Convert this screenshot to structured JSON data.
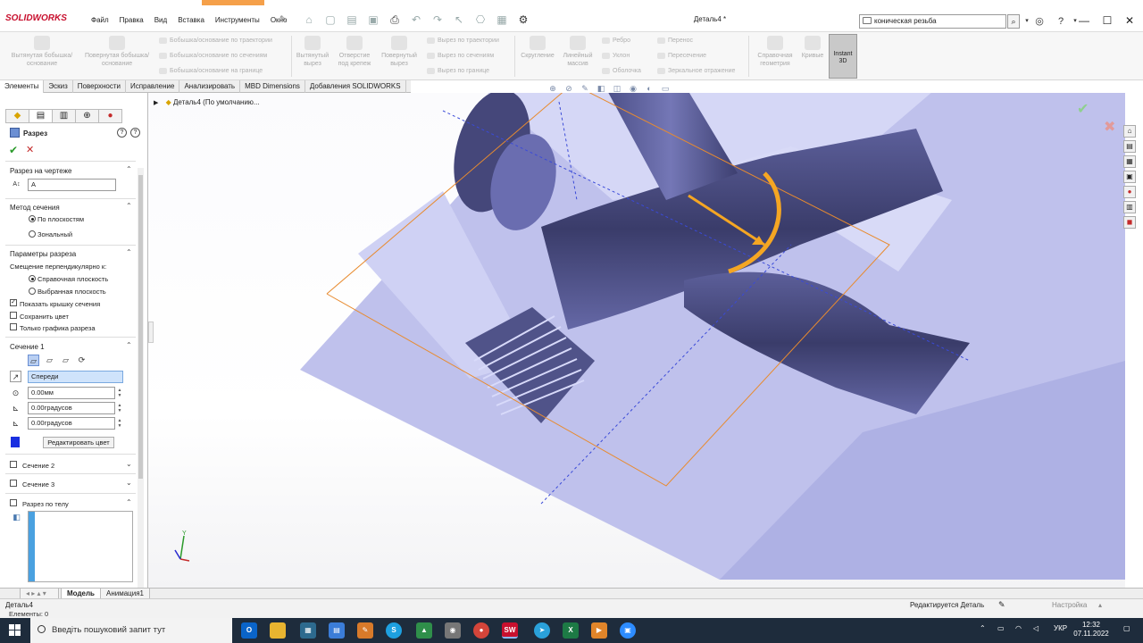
{
  "app": {
    "logo_text": "SOLIDWORKS",
    "doc_title": "Деталь4 *",
    "menu": [
      "Файл",
      "Правка",
      "Вид",
      "Вставка",
      "Инструменты",
      "Окно"
    ],
    "search_value": "коническая резьба"
  },
  "ribbon": {
    "extrude_boss": "Вытянутая бобышка/основание",
    "revolve_boss": "Повернутая бобышка/основание",
    "sweep_boss": "Бобышка/основание по траектории",
    "loft_boss": "Бобышка/основание по сечениям",
    "boundary_boss": "Бобышка/основание на границе",
    "extrude_cut": "Вытянутый вырез",
    "hole_wizard": "Отверстие под крепеж",
    "revolve_cut": "Повернутый вырез",
    "sweep_cut": "Вырез по траектории",
    "loft_cut": "Вырез по сечениям",
    "boundary_cut": "Вырез по границе",
    "fillet": "Скругление",
    "linear_pattern": "Линейный массив",
    "rib": "Ребро",
    "draft": "Уклон",
    "shell": "Оболочка",
    "wrap": "Перенос",
    "intersect": "Пересечение",
    "mirror": "Зеркальное отражение",
    "ref_geometry": "Справочная геометрия",
    "curves": "Кривые",
    "instant3d": "Instant 3D"
  },
  "tabs": [
    "Элементы",
    "Эскиз",
    "Поверхности",
    "Исправление",
    "Анализировать",
    "MBD Dimensions",
    "Добавления SOLIDWORKS"
  ],
  "panel": {
    "title": "Разрез",
    "section_drawing": {
      "header": "Разрез на чертеже",
      "value": "A"
    },
    "method": {
      "header": "Метод сечения",
      "opt_planes": "По плоскостям",
      "opt_zonal": "Зональный"
    },
    "params": {
      "header": "Параметры разреза",
      "offset_label": "Смещение перпендикулярно к:",
      "opt_ref_plane": "Справочная плоскость",
      "opt_sel_plane": "Выбранная плоскость",
      "show_cap": "Показать крышку сечения",
      "keep_color": "Сохранить цвет",
      "graphics_only": "Только графика разреза"
    },
    "section1": {
      "header": "Сечение 1",
      "plane": "Спереди",
      "offset": "0.00мм",
      "angle1": "0.00градусов",
      "angle2": "0.00градусов",
      "edit_color": "Редактировать цвет",
      "cap_color": "#1a2fe0"
    },
    "section2": "Сечение 2",
    "section3": "Сечение 3",
    "by_body": "Разрез по телу"
  },
  "tree": {
    "root": "Деталь4 (По умолчанию..."
  },
  "bottom_tabs": [
    "Модель",
    "Анимация1"
  ],
  "status": {
    "doc_name": "Деталь4",
    "elements": "Елементы: 0",
    "editing": "Редактируется Деталь",
    "custom": "Настройка"
  },
  "taskbar": {
    "search_placeholder": "Введіть пошуковий запит тут",
    "lang": "УКР",
    "time": "12:32",
    "date": "07.11.2022"
  },
  "colors": {
    "model_light": "#c7c9ef",
    "model_dark": "#3b3d6e",
    "handle": "#f5a623"
  }
}
